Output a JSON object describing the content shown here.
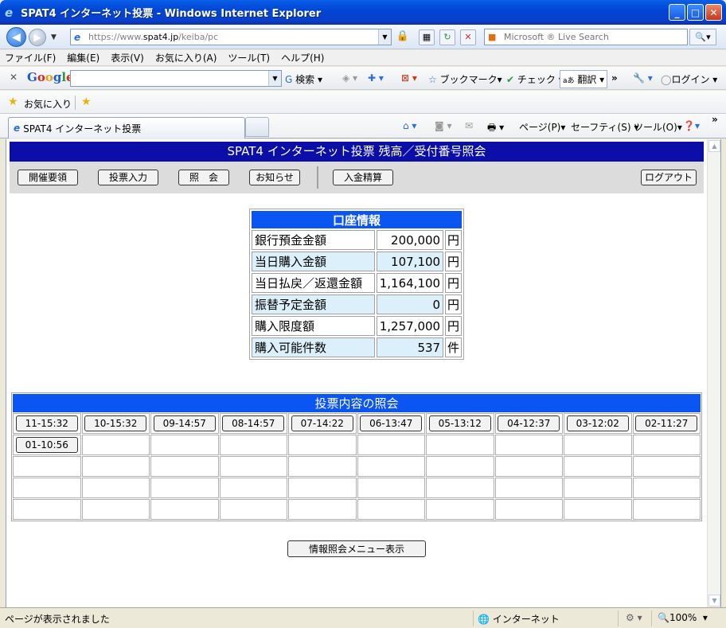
{
  "window": {
    "title": "SPAT4 インターネット投票 - Windows Internet Explorer"
  },
  "address": {
    "url_prefix": "https://www.",
    "url_domain": "spat4.jp",
    "url_path": "/keiba/pc",
    "search_placeholder": "Microsoft ® Live Search"
  },
  "menu": [
    "ファイル(F)",
    "編集(E)",
    "表示(V)",
    "お気に入り(A)",
    "ツール(T)",
    "ヘルプ(H)"
  ],
  "google_toolbar": {
    "logo": [
      "G",
      "o",
      "o",
      "g",
      "l",
      "e"
    ],
    "search_label": "検索",
    "bookmark_label": "ブックマーク",
    "check_label": "チェック",
    "translate_label": "翻訳",
    "login_label": "ログイン"
  },
  "favorites": {
    "label": "お気に入り"
  },
  "tabs": {
    "active_label": "SPAT4 インターネット投票"
  },
  "command_bar": {
    "page": "ページ(P)",
    "safety": "セーフティ(S)",
    "tools": "ツール(O)"
  },
  "page": {
    "header_title": "SPAT4 インターネット投票 残高／受付番号照会",
    "nav": {
      "schedule": "開催要領",
      "vote_input": "投票入力",
      "inquiry": "照　会",
      "notice": "お知らせ",
      "deposit": "入金精算",
      "logout": "ログアウト"
    },
    "account": {
      "title": "口座情報",
      "rows": [
        {
          "label": "銀行預金金額",
          "value": "200,000",
          "unit": "円"
        },
        {
          "label": "当日購入金額",
          "value": "107,100",
          "unit": "円"
        },
        {
          "label": "当日払戻／返還金額",
          "value": "1,164,100",
          "unit": "円"
        },
        {
          "label": "振替予定金額",
          "value": "0",
          "unit": "円"
        },
        {
          "label": "購入限度額",
          "value": "1,257,000",
          "unit": "円"
        },
        {
          "label": "購入可能件数",
          "value": "537",
          "unit": "件"
        }
      ]
    },
    "inquiry": {
      "title": "投票内容の照会",
      "receipts": [
        "11-15:32",
        "10-15:32",
        "09-14:57",
        "08-14:57",
        "07-14:22",
        "06-13:47",
        "05-13:12",
        "04-12:37",
        "03-12:02",
        "02-11:27",
        "01-10:56"
      ]
    },
    "menu_button": "情報照会メニュー表示"
  },
  "status": {
    "text": "ページが表示されました",
    "zone": "インターネット",
    "zoom": "100%"
  },
  "colors": {
    "header_bg": "#0b0fa8",
    "table_header_bg": "#0b56f2",
    "row_highlight": "#dcf0fb",
    "nav_bg": "#dcdcdc"
  }
}
